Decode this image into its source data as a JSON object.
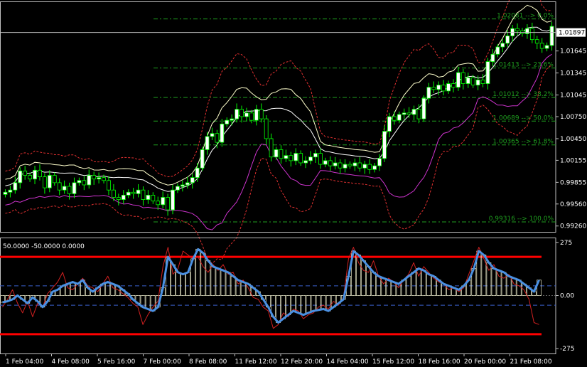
{
  "colors": {
    "background": "#000000",
    "frame": "#c0c0c0",
    "bull_candle": "#ffffff",
    "bear_candle": "#000000",
    "candle_outline": "#00ff00",
    "fib": "#1f9f1f",
    "outer_band": "#ffffcc",
    "inner_band": "#ffffff",
    "red_band": "#e03030",
    "magenta": "#cc33cc",
    "cci": "#4a90e2",
    "cci_fast": "#d02020",
    "level_red": "#ff0000",
    "level_blue": "#3a5fcd"
  },
  "header": {
    "indicator_values": "50.0000 -50.0000 0.0000"
  },
  "price_pane": {
    "current_price_label": "1.01897",
    "yticks": [
      "1.01645",
      "1.01345",
      "1.01045",
      "1.00750",
      "1.00450",
      "1.00155",
      "0.99855",
      "0.99560",
      "0.99260"
    ],
    "fib_labels": [
      "1.02081 --> 0.0%",
      "1.01413 --> 23.6%",
      "1.01012 --> 38.2%",
      "1.00689 --> 50.0%",
      "1.00365 --> 61.8%",
      "0.99316 --> 100.0%"
    ]
  },
  "indicator_pane": {
    "yticks": [
      "275",
      "0.00",
      "-275"
    ]
  },
  "xaxis": {
    "labels": [
      "1 Feb 04:00",
      "4 Feb 08:00",
      "5 Feb 16:00",
      "7 Feb 00:00",
      "8 Feb 08:00",
      "11 Feb 12:00",
      "12 Feb 20:00",
      "14 Feb 04:00",
      "15 Feb 12:00",
      "18 Feb 16:00",
      "20 Feb 00:00",
      "21 Feb 08:00"
    ]
  },
  "chart_data": [
    {
      "type": "candlestick",
      "title": "",
      "ylim": [
        0.9918,
        1.0232
      ],
      "current_price": 1.01897,
      "fibonacci_levels": [
        {
          "price": 1.02081,
          "label": "0.0%"
        },
        {
          "price": 1.01413,
          "label": "23.6%"
        },
        {
          "price": 1.01012,
          "label": "38.2%"
        },
        {
          "price": 1.00689,
          "label": "50.0%"
        },
        {
          "price": 1.00365,
          "label": "61.8%"
        },
        {
          "price": 0.99316,
          "label": "100.0%"
        }
      ],
      "close": [
        0.9972,
        0.9975,
        0.9985,
        1.0001,
        0.9995,
        0.999,
        1.0002,
        0.9993,
        0.9978,
        0.9995,
        0.9985,
        0.9975,
        0.998,
        0.997,
        0.9985,
        0.9988,
        0.9982,
        0.9995,
        0.999,
        0.9992,
        0.9988,
        0.9975,
        0.9965,
        0.9962,
        0.9968,
        0.9972,
        0.997,
        0.9975,
        0.9962,
        0.9968,
        0.996,
        0.9955,
        0.9965,
        0.9948,
        0.9975,
        0.998,
        0.9982,
        0.9985,
        0.9992,
        1.0005,
        1.003,
        1.0048,
        1.0052,
        1.004,
        1.0065,
        1.007,
        1.0072,
        1.0085,
        1.0075,
        1.008,
        1.007,
        1.0085,
        1.0072,
        1.0045,
        1.002,
        1.003,
        1.0018,
        1.0022,
        1.0015,
        1.0025,
        1.0012,
        1.0015,
        1.002,
        1.0025,
        1.001,
        1.0015,
        1.0008,
        1.0012,
        1.0005,
        1.001,
        1.0008,
        1.0012,
        1.0005,
        1.001,
        1.0003,
        1.0008,
        1.0018,
        1.0055,
        1.0075,
        1.007,
        1.0078,
        1.008,
        1.0078,
        1.0085,
        1.0072,
        1.01,
        1.0115,
        1.0112,
        1.0118,
        1.011,
        1.012,
        1.0115,
        1.0135,
        1.012,
        1.0128,
        1.0118,
        1.0125,
        1.012,
        1.015,
        1.016,
        1.017,
        1.0175,
        1.0185,
        1.0195,
        1.0192,
        1.0188,
        1.0195,
        1.018,
        1.0175,
        1.0168,
        1.0172,
        1.0198
      ]
    },
    {
      "type": "line",
      "title": "",
      "ylim": [
        -300,
        300
      ],
      "levels": [
        200,
        50,
        0,
        -50,
        -200
      ],
      "series": [
        {
          "values": [
            -35,
            -30,
            -20,
            0,
            -20,
            -40,
            -10,
            -30,
            -60,
            -30,
            20,
            30,
            50,
            60,
            70,
            60,
            80,
            40,
            20,
            40,
            60,
            70,
            60,
            50,
            30,
            10,
            -20,
            -40,
            -60,
            -70,
            -80,
            -60,
            40,
            200,
            160,
            120,
            110,
            120,
            190,
            240,
            220,
            180,
            150,
            140,
            130,
            120,
            100,
            80,
            70,
            60,
            40,
            20,
            -20,
            -60,
            -110,
            -140,
            -120,
            -100,
            -80,
            -90,
            -100,
            -90,
            -80,
            -75,
            -70,
            -80,
            -60,
            -40,
            -20,
            100,
            230,
            210,
            180,
            150,
            120,
            100,
            90,
            80,
            70,
            60,
            80,
            100,
            120,
            140,
            130,
            110,
            100,
            80,
            60,
            50,
            40,
            30,
            50,
            80,
            140,
            230,
            210,
            170,
            140,
            130,
            120,
            100,
            90,
            80,
            60,
            40,
            20,
            80
          ]
        },
        {
          "values": [
            -60,
            -20,
            30,
            -40,
            -90,
            -30,
            -110,
            -40,
            -60,
            10,
            40,
            70,
            120,
            40,
            30,
            60,
            90,
            50,
            40,
            20,
            60,
            100,
            40,
            30,
            10,
            -10,
            -40,
            -60,
            -150,
            -100,
            -60,
            -30,
            150,
            250,
            110,
            140,
            230,
            210,
            190,
            200,
            150,
            120,
            160,
            130,
            160,
            110,
            120,
            60,
            80,
            40,
            -10,
            -20,
            -60,
            -80,
            -170,
            -150,
            -90,
            -110,
            -70,
            -80,
            -120,
            -100,
            -90,
            -60,
            -50,
            -70,
            -30,
            -50,
            -10,
            190,
            250,
            170,
            130,
            120,
            180,
            100,
            60,
            90,
            70,
            40,
            80,
            110,
            170,
            100,
            150,
            120,
            90,
            70,
            60,
            30,
            40,
            20,
            40,
            110,
            180,
            250,
            190,
            130,
            160,
            100,
            90,
            110,
            60,
            50,
            30,
            -20,
            -140,
            -150
          ]
        }
      ]
    }
  ]
}
